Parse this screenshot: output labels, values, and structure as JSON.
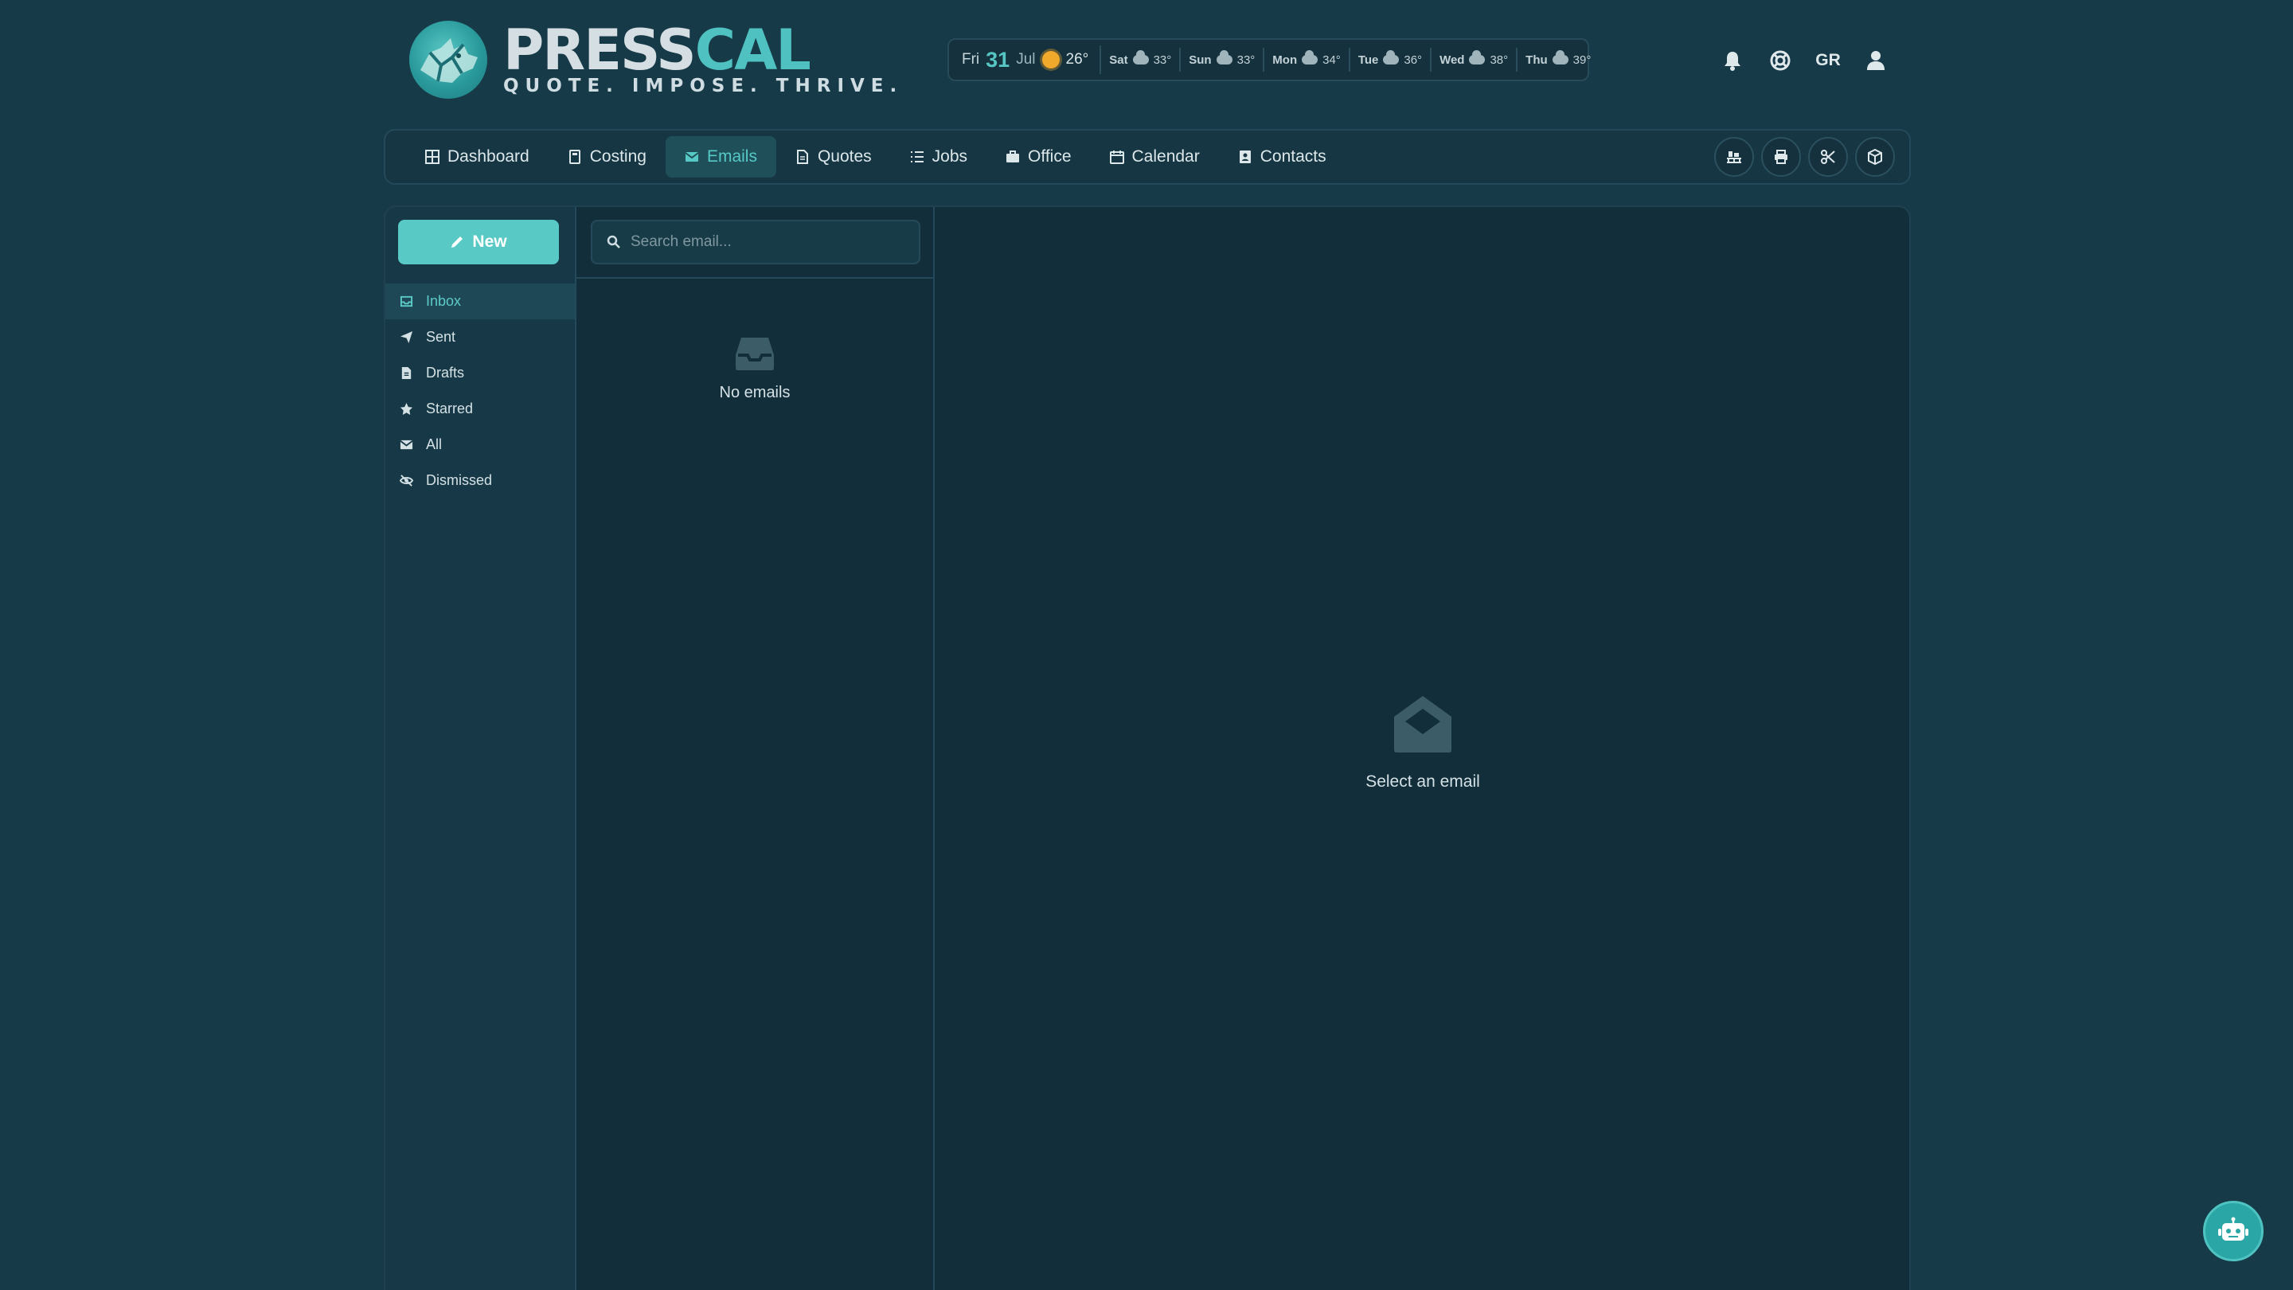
{
  "brand": {
    "name_part1": "PRESS",
    "name_part2": "CAL",
    "tagline": "QUOTE. IMPOSE. THRIVE."
  },
  "weather": {
    "today": {
      "weekday": "Fri",
      "day": "31",
      "month": "Jul",
      "temp": "26°",
      "icon": "sun-icon"
    },
    "forecast": [
      {
        "day": "Sat",
        "temp": "33°",
        "icon": "cloud-icon"
      },
      {
        "day": "Sun",
        "temp": "33°",
        "icon": "cloud-icon"
      },
      {
        "day": "Mon",
        "temp": "34°",
        "icon": "cloud-icon"
      },
      {
        "day": "Tue",
        "temp": "36°",
        "icon": "cloud-icon"
      },
      {
        "day": "Wed",
        "temp": "38°",
        "icon": "cloud-icon"
      },
      {
        "day": "Thu",
        "temp": "39°",
        "icon": "cloud-icon"
      }
    ]
  },
  "header": {
    "language": "GR"
  },
  "nav": {
    "items": [
      {
        "label": "Dashboard",
        "icon": "grid-icon"
      },
      {
        "label": "Costing",
        "icon": "calculator-icon"
      },
      {
        "label": "Emails",
        "icon": "envelope-icon",
        "active": true
      },
      {
        "label": "Quotes",
        "icon": "file-icon"
      },
      {
        "label": "Jobs",
        "icon": "list-icon"
      },
      {
        "label": "Office",
        "icon": "briefcase-icon"
      },
      {
        "label": "Calendar",
        "icon": "calendar-icon"
      },
      {
        "label": "Contacts",
        "icon": "address-book-icon"
      }
    ],
    "tools": [
      "pallet-icon",
      "printer-icon",
      "scissors-icon",
      "box-icon"
    ]
  },
  "mail": {
    "new_label": "New",
    "folders": [
      {
        "label": "Inbox",
        "icon": "inbox-icon",
        "active": true
      },
      {
        "label": "Sent",
        "icon": "paper-plane-icon"
      },
      {
        "label": "Drafts",
        "icon": "file-icon"
      },
      {
        "label": "Starred",
        "icon": "star-icon"
      },
      {
        "label": "All",
        "icon": "envelope-icon"
      },
      {
        "label": "Dismissed",
        "icon": "eye-slash-icon"
      }
    ],
    "search_placeholder": "Search email...",
    "empty_list": "No emails",
    "empty_reader": "Select an email"
  },
  "colors": {
    "background": "#173a48",
    "accent": "#56c8c6",
    "panel": "#122e3a"
  }
}
